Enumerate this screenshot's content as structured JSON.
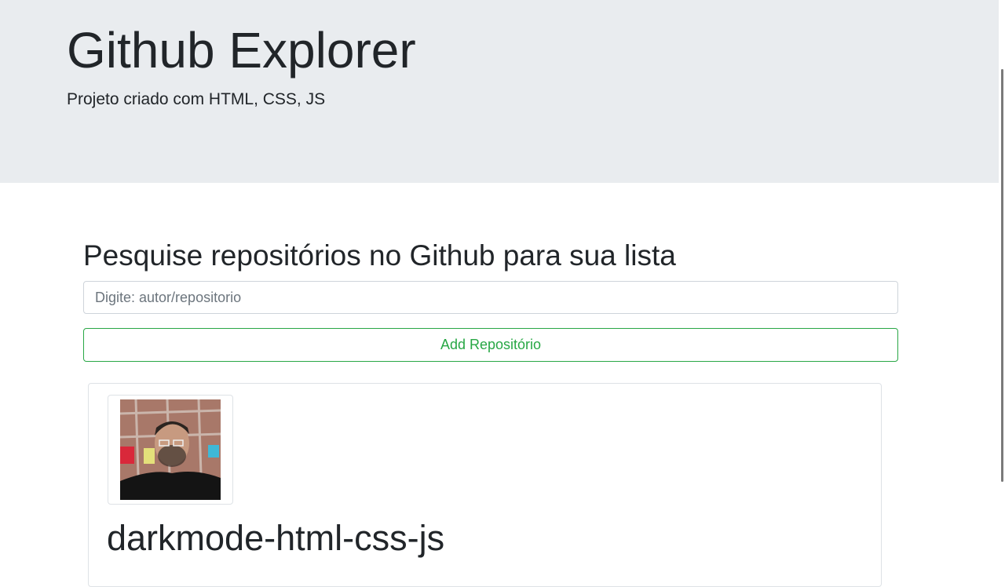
{
  "header": {
    "title": "Github Explorer",
    "subtitle": "Projeto criado com HTML, CSS, JS"
  },
  "search": {
    "heading": "Pesquise repositórios no Github para sua lista",
    "placeholder": "Digite: autor/repositorio",
    "value": "",
    "button_label": "Add Repositório"
  },
  "repositories": [
    {
      "name": "darkmode-html-css-js",
      "avatar_icon": "user-avatar-photo"
    }
  ],
  "colors": {
    "header_bg": "#e9ecef",
    "accent_green": "#28a745",
    "text": "#212529"
  }
}
